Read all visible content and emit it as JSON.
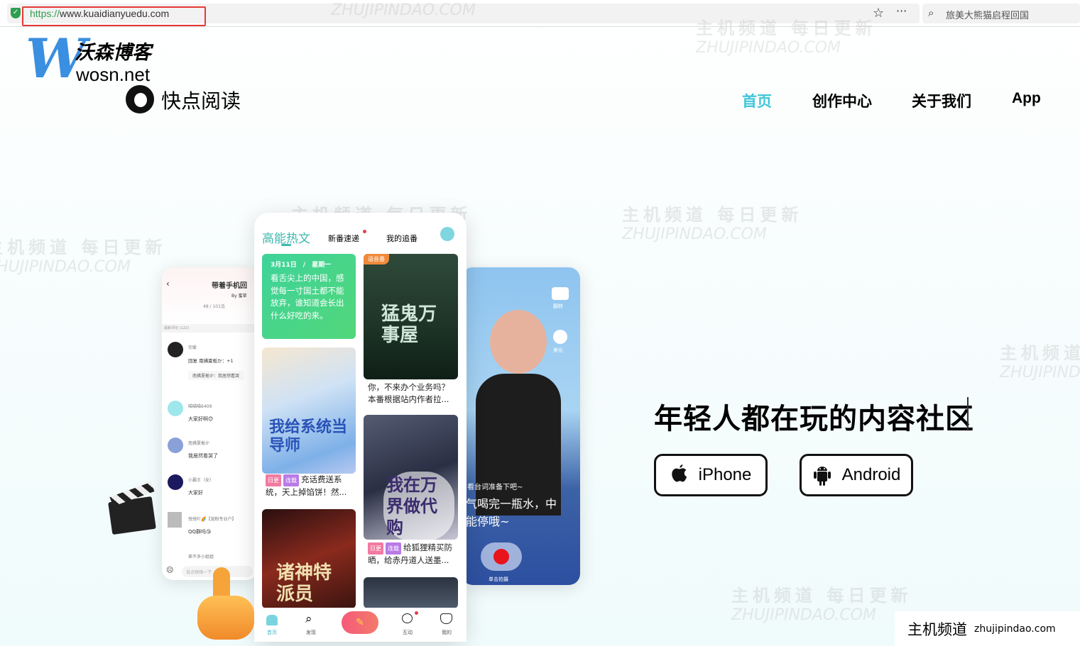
{
  "browser": {
    "url_scheme": "https://",
    "url_rest": "www.kuaidianyuedu.com",
    "search_text": "旅美大熊猫启程回国",
    "star_icon": "star-icon",
    "more_icon": "more-icon",
    "search_icon": "search-icon"
  },
  "watermark": {
    "cn": "主机频道 每日更新",
    "en": "ZHUJIPINDAO.COM"
  },
  "blog_logo": {
    "letter": "W",
    "title": "沃森博客",
    "domain": "wosn.net"
  },
  "site": {
    "name": "快点阅读"
  },
  "nav": [
    {
      "label": "首页",
      "active": true
    },
    {
      "label": "创作中心"
    },
    {
      "label": "关于我们"
    },
    {
      "label": "App"
    }
  ],
  "left_screen": {
    "title": "带着手机回",
    "author": "By 蜜草",
    "progress": "48 / 101话",
    "section": "最新评论 (122)",
    "comments": [
      {
        "user": "勿爱",
        "text": "回复 南拂夏栀か：+1",
        "quote": "南拂夏栀か：我居然看哭"
      },
      {
        "user": "喵喵喵6409",
        "text": "大家好啊😊"
      },
      {
        "user": "南拂夏栀か",
        "text": "我居然看哭了"
      },
      {
        "user": "小霸王（女）",
        "text": "大家好"
      },
      {
        "user": "悦悦吖🌈【宠粉专业户】",
        "text": "QQ群吗😘"
      },
      {
        "user": "差不多小姐姐",
        "text": ""
      }
    ],
    "input_placeholder": "说点啥嗨一下"
  },
  "center_screen": {
    "tabs": [
      "高能热文",
      "新番速递",
      "我的追番"
    ],
    "green_card": {
      "date": "3月11日　/　星期一",
      "text": "看舌尖上的中国，感觉每一寸国土都不能放弃，谁知道会长出什么好吃的来。"
    },
    "audio_badge": "语音番",
    "cards": [
      {
        "cover": "猛鬼万事屋",
        "caption": "你，不来办个业务吗？本番根据站内作者拉..."
      },
      {
        "cover": "我给系统当导师",
        "tags": [
          "日更",
          "连载"
        ],
        "caption": "充话费送系统，天上掉馅饼！然..."
      },
      {
        "cover": "我在万界做代购",
        "tags": [
          "日更",
          "连载"
        ],
        "caption": "给狐狸精买防晒，给赤丹道人送墨..."
      },
      {
        "cover": "诸神特派员"
      }
    ],
    "tabbar": [
      {
        "label": "首页",
        "icon": "home-icon"
      },
      {
        "label": "发现",
        "icon": "search-icon"
      },
      {
        "label": "",
        "icon": "pencil-icon"
      },
      {
        "label": "互动",
        "icon": "chat-icon"
      },
      {
        "label": "我的",
        "icon": "cat-icon"
      }
    ]
  },
  "right_screen": {
    "flip": "翻转",
    "beauty": "美化",
    "line1": "看台词准备下吧~",
    "line2": "气喝完一瓶水，中",
    "line3": "能停哦~",
    "record": "单击拍摄"
  },
  "hero": {
    "title": "年轻人都在玩的内容社区",
    "iphone": "iPhone",
    "android": "Android"
  },
  "badge": {
    "cn": "主机频道",
    "en": "zhujipindao.com"
  },
  "colors": {
    "accent": "#3fc6d8",
    "blog_blue": "#3a8fe0",
    "url_highlight": "#e53935",
    "record": "#e8131b"
  }
}
